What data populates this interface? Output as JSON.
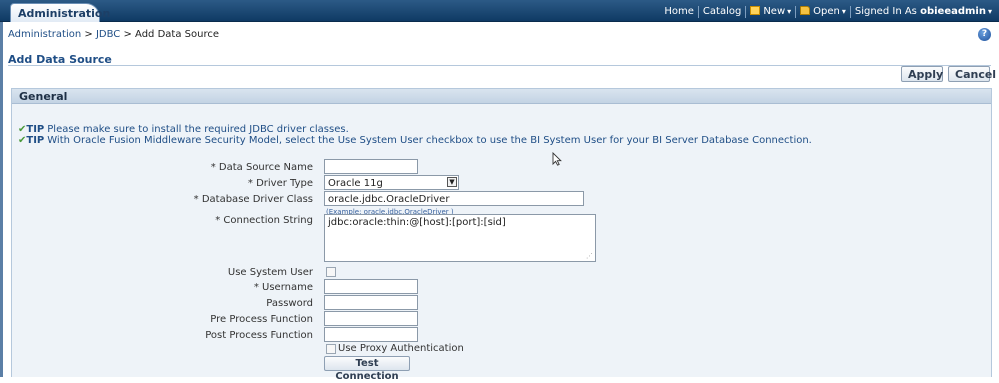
{
  "header": {
    "app_tab": "Administration",
    "links": {
      "home": "Home",
      "catalog": "Catalog",
      "new": "New",
      "open": "Open",
      "signed_in_as": "Signed In As",
      "user": "obieeadmin"
    }
  },
  "breadcrumb": {
    "root": "Administration",
    "sep1": ">",
    "middle": "JDBC",
    "sep2": ">",
    "current": "Add Data Source"
  },
  "help": {
    "glyph": "?"
  },
  "page_title": "Add Data Source",
  "toolbar": {
    "apply_label": "Apply",
    "cancel_label": "Cancel"
  },
  "panel": {
    "title": "General",
    "tip_mark": "✔",
    "tip_label": "TIP",
    "tips": [
      "Please make sure to install the required JDBC driver classes.",
      "With Oracle Fusion Middleware Security Model, select the Use System User checkbox to use the BI System User for your BI Server Database Connection."
    ]
  },
  "form": {
    "data_source_name": {
      "label": "* Data Source Name",
      "value": ""
    },
    "driver_type": {
      "label": "* Driver Type",
      "value": "Oracle 11g"
    },
    "database_driver_class": {
      "label": "* Database Driver Class",
      "value": "oracle.jdbc.OracleDriver",
      "example": "(Example: oracle.jdbc.OracleDriver )"
    },
    "connection_string": {
      "label": "* Connection String",
      "value": "jdbc:oracle:thin:@[host]:[port]:[sid]"
    },
    "use_system_user": {
      "label": "Use System User",
      "checked": false
    },
    "username": {
      "label": "* Username",
      "value": ""
    },
    "password": {
      "label": "Password",
      "value": ""
    },
    "pre_process_function": {
      "label": "Pre Process Function",
      "value": ""
    },
    "post_process_function": {
      "label": "Post Process Function",
      "value": ""
    },
    "use_proxy_authentication": {
      "label": "Use Proxy Authentication",
      "checked": false
    },
    "test_connection_label": "Test Connection"
  },
  "icons": {
    "tip": "check-icon",
    "help": "help-icon",
    "new": "new-document-icon",
    "open": "folder-icon",
    "select": "dropdown-arrow-icon",
    "cursor": "mouse-cursor-icon"
  },
  "colors": {
    "header": "#0f3a64",
    "link": "#1f4e86",
    "panel_bg": "#eef3f8",
    "tip_check": "#4b9a3c"
  }
}
